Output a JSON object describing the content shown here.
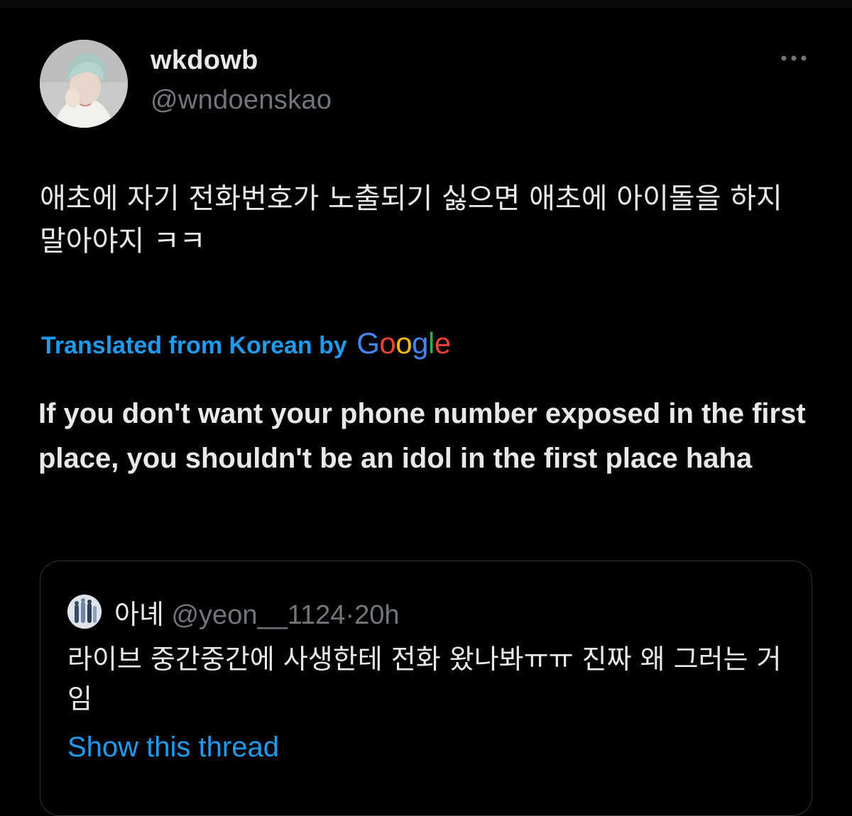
{
  "tweet": {
    "display_name": "wkdowb",
    "handle": "@wndoenskao",
    "original_text": "애초에 자기 전화번호가 노출되기 싫으면 애초에 아이돌을 하지 말아야지 ㅋㅋ",
    "translated_label": "Translated from Korean by",
    "translation_provider": "Google",
    "translated_text": "If you don't want your phone number exposed in the first place, you shouldn't be an idol in the first place haha",
    "more_icon": "more-horizontal-icon"
  },
  "quote": {
    "display_name": "아녜",
    "handle": "@yeon__1124",
    "separator": "·",
    "time": "20h",
    "text": "라이브 중간중간에 사생한테 전화 왔나봐ㅠㅠ 진짜 왜 그러는 거임",
    "show_thread_label": "Show this thread"
  },
  "colors": {
    "background": "#000000",
    "text_primary": "#e7e9ea",
    "text_secondary": "#71767b",
    "accent": "#1d9bf0",
    "border": "#2f3336",
    "google_blue": "#4285F4",
    "google_red": "#EA4335",
    "google_yellow": "#FBBC05",
    "google_green": "#34A853"
  }
}
